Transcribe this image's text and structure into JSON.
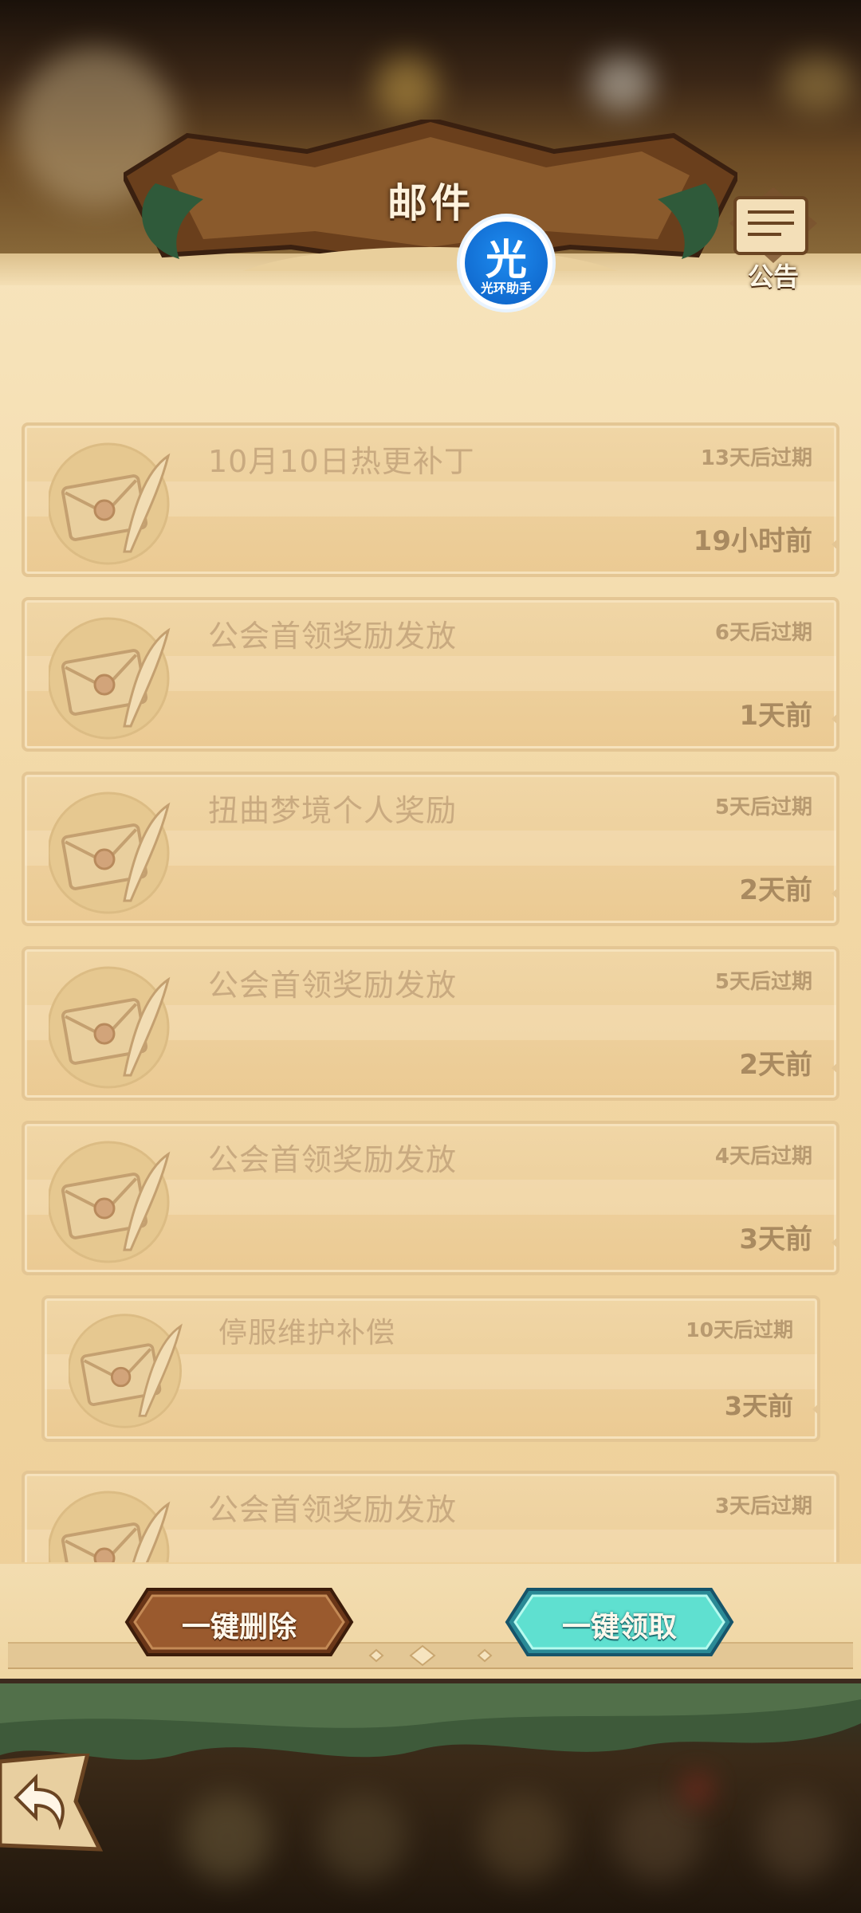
{
  "header": {
    "title": "邮件",
    "logo_glyph": "光",
    "logo_caption": "光环助手",
    "notice_label": "公告"
  },
  "mails": [
    {
      "title": "10月10日热更补丁",
      "expire": "13天后过期",
      "time": "19小时前"
    },
    {
      "title": "公会首领奖励发放",
      "expire": "6天后过期",
      "time": "1天前"
    },
    {
      "title": "扭曲梦境个人奖励",
      "expire": "5天后过期",
      "time": "2天前"
    },
    {
      "title": "公会首领奖励发放",
      "expire": "5天后过期",
      "time": "2天前"
    },
    {
      "title": "公会首领奖励发放",
      "expire": "4天后过期",
      "time": "3天前"
    },
    {
      "title": "停服维护补偿",
      "expire": "10天后过期",
      "time": "3天前"
    },
    {
      "title": "公会首领奖励发放",
      "expire": "3天后过期",
      "time": ""
    }
  ],
  "actions": {
    "delete_all": "一键删除",
    "claim_all": "一键领取"
  },
  "colors": {
    "panel": "#f2d8a6",
    "card_border": "#e4c694",
    "delete_button": "#8a4a22",
    "claim_button": "#4fd6c8",
    "logo_blue": "#1e8cf0"
  },
  "icons": {
    "mail_icon": "envelope-quill-icon",
    "notice_icon": "scroll-icon",
    "back_icon": "back-arrow-icon"
  }
}
